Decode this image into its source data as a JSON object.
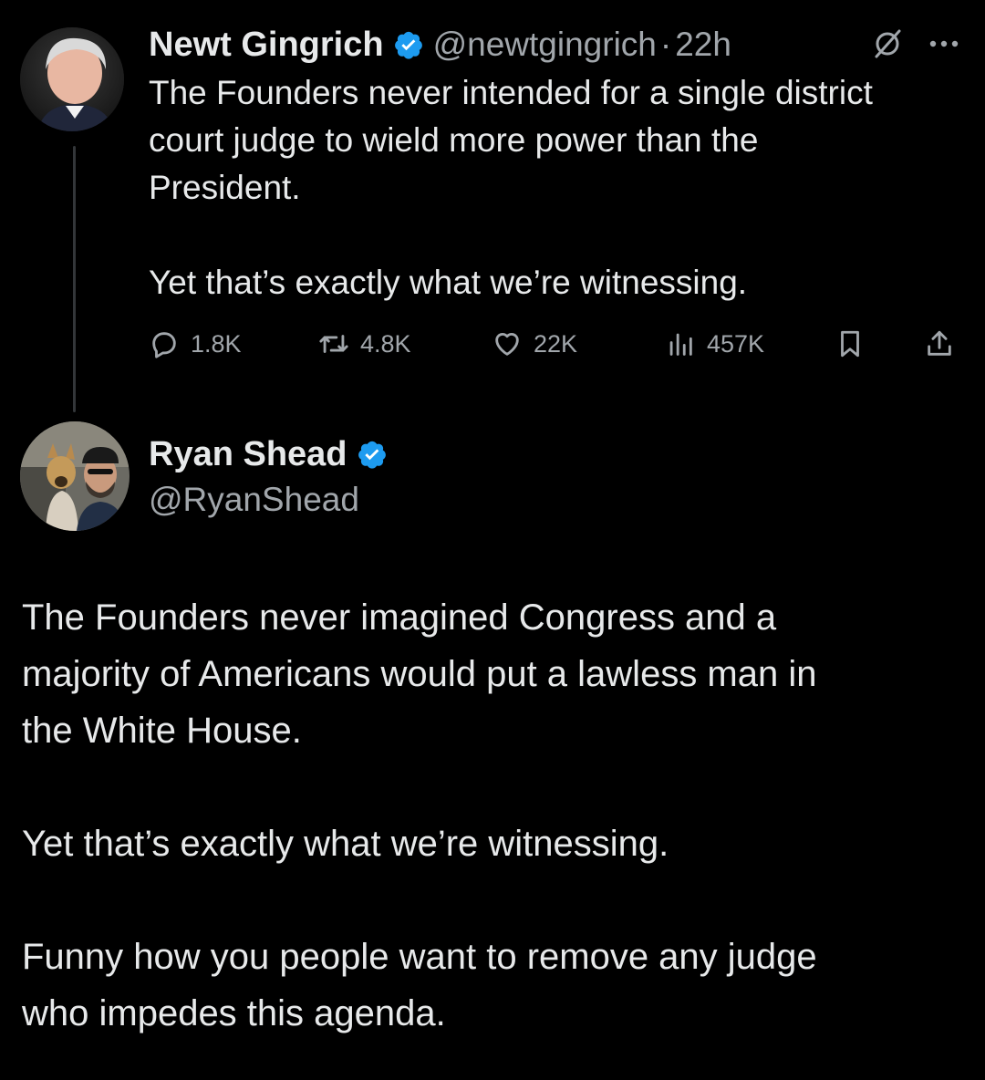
{
  "tweet1": {
    "author_name": "Newt Gingrich",
    "handle": "@newtgingrich",
    "separator": "·",
    "time": "22h",
    "body_line1": "The Founders never intended for a single district",
    "body_line2": "court judge to wield more power than the",
    "body_line3": "President.",
    "body_line4": "Yet that’s exactly what we’re witnessing.",
    "stats": {
      "replies": "1.8K",
      "retweets": "4.8K",
      "likes": "22K",
      "views": "457K"
    }
  },
  "tweet2": {
    "author_name": "Ryan Shead",
    "handle": "@RyanShead",
    "para1_line1": "The Founders never imagined Congress and a",
    "para1_line2": "majority of Americans would put a lawless man in",
    "para1_line3": "the White House.",
    "para2": "Yet that’s exactly what we’re witnessing.",
    "para3_line1": "Funny how you people want to remove any judge",
    "para3_line2": "who impedes this agenda."
  },
  "icons": {
    "verified": "verified-badge-icon",
    "grok": "grok-icon",
    "more": "more-icon",
    "reply": "reply-icon",
    "retweet": "retweet-icon",
    "like": "heart-icon",
    "views": "views-icon",
    "bookmark": "bookmark-icon",
    "share": "share-icon"
  },
  "colors": {
    "background": "#000000",
    "text": "#e7e9ea",
    "secondary": "#a1a6ab",
    "verified": "#1d9bf0",
    "thread_line": "#333639"
  }
}
